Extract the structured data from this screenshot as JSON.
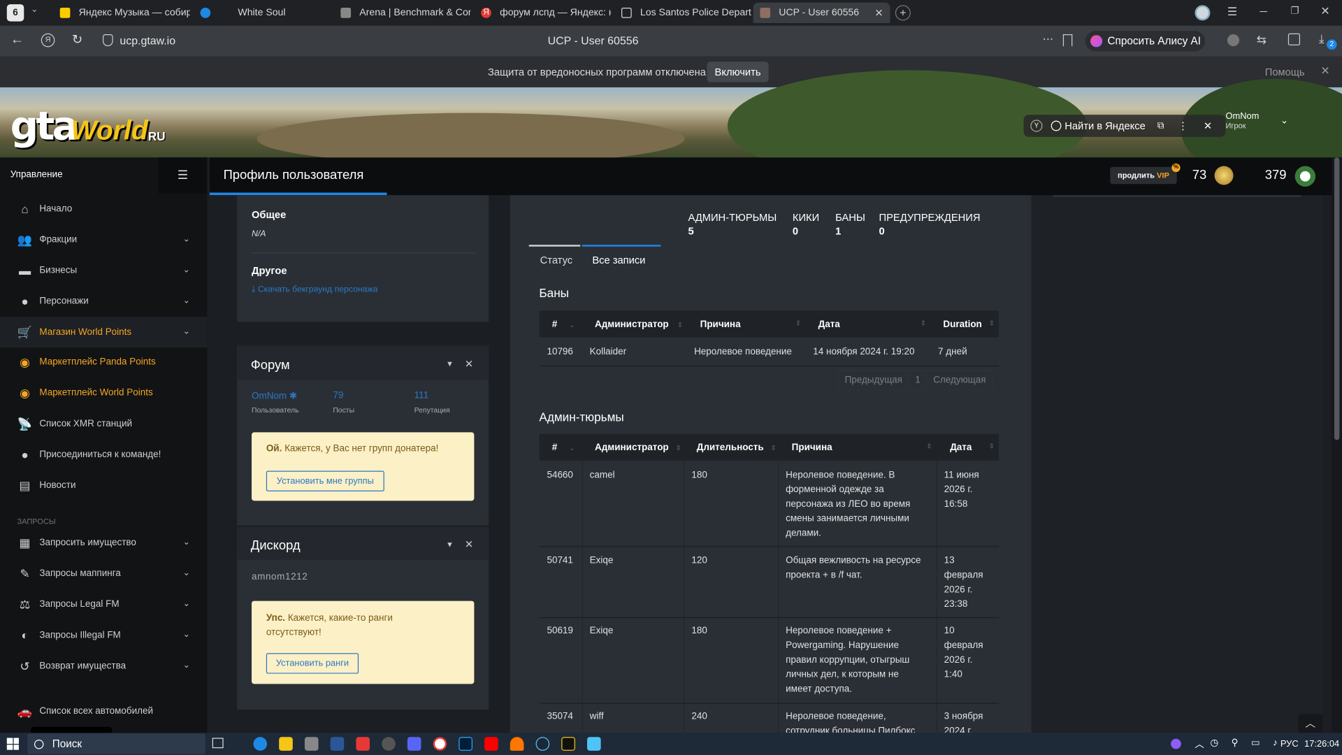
{
  "browser": {
    "tab_counter": "6",
    "tabs": [
      {
        "label": "Яндекс Музыка — собирае",
        "color": "#ffcc00"
      },
      {
        "label": "White Soul",
        "color": "#1e88e5"
      },
      {
        "label": "Arena | Benchmark & Com",
        "color": "#888888"
      },
      {
        "label": "форум лспд — Яндекс: на",
        "color": "#e53935"
      },
      {
        "label": "Los Santos Police Departm",
        "color": "#cfd8dc"
      },
      {
        "label": "UCP - User 60556",
        "color": "#8d6e63"
      }
    ],
    "url": "ucp.gtaw.io",
    "page_title": "UCP - User 60556",
    "alice_button": "Спросить Алису AI",
    "download_badge": "2"
  },
  "notice": {
    "text": "Защита от вредоносных программ отключена",
    "enable_button": "Включить",
    "help": "Помощь"
  },
  "banner": {
    "logo_gta": "gta",
    "logo_world": "World",
    "logo_ru": "RU",
    "yandex_search": "Найти в Яндексе",
    "user_name": "OmNom",
    "user_role": "Игрок"
  },
  "sidebar": {
    "title": "Управление",
    "items": [
      {
        "label": "Начало",
        "icon": "home-icon"
      },
      {
        "label": "Фракции",
        "icon": "users-icon"
      },
      {
        "label": "Бизнесы",
        "icon": "briefcase-icon"
      },
      {
        "label": "Персонажи",
        "icon": "person-icon"
      },
      {
        "label": "Магазин World Points",
        "icon": "cart-icon"
      },
      {
        "label": "Маркетплейс Panda Points",
        "icon": "coins-icon"
      },
      {
        "label": "Маркетплейс World Points",
        "icon": "coins-icon"
      },
      {
        "label": "Список XMR станций",
        "icon": "radio-icon"
      },
      {
        "label": "Присоединиться к команде!",
        "icon": "person-plus-icon"
      },
      {
        "label": "Новости",
        "icon": "news-icon"
      }
    ],
    "section_requests": "ЗАПРОСЫ",
    "requests": [
      {
        "label": "Запросить имущество",
        "icon": "building-icon"
      },
      {
        "label": "Запросы маппинга",
        "icon": "brush-icon"
      },
      {
        "label": "Запросы Legal FM",
        "icon": "scale-icon"
      },
      {
        "label": "Запросы Illegal FM",
        "icon": "mask-icon"
      },
      {
        "label": "Возврат имущества",
        "icon": "undo-icon"
      }
    ],
    "all_vehicles": "Список всех автомобилей"
  },
  "header": {
    "title": "Профиль пользователя",
    "vip_button": "продлить",
    "vip_label": "VIP",
    "points_world": "73",
    "points_panda": "379"
  },
  "profile": {
    "general_label": "Общее",
    "general_value": "N/A",
    "other_label": "Другое",
    "download_link": "Скачать бекграунд персонажа"
  },
  "forum": {
    "title": "Форум",
    "user": "OmNom",
    "user_caption": "Пользователь",
    "posts": "79",
    "posts_caption": "Посты",
    "rep": "111",
    "rep_caption": "Репутация",
    "warn_bold": "Ой.",
    "warn_text": "Кажется, у Вас нет групп донатера!",
    "warn_button": "Установить мне группы"
  },
  "discord": {
    "title": "Дискорд",
    "username": "amnom1212",
    "warn_bold": "Упс.",
    "warn_text_1": "Кажется, какие-то ранги",
    "warn_text_2": "отсутствуют!",
    "warn_button": "Установить ранги"
  },
  "stats": [
    {
      "label": "АДМИН-ТЮРЬМЫ",
      "value": "5"
    },
    {
      "label": "КИКИ",
      "value": "0"
    },
    {
      "label": "БАНЫ",
      "value": "1"
    },
    {
      "label": "ПРЕДУПРЕЖДЕНИЯ",
      "value": "0"
    }
  ],
  "tabs": {
    "status": "Статус",
    "all": "Все записи"
  },
  "bans": {
    "title": "Баны",
    "headers": [
      "#",
      "Администратор",
      "Причина",
      "Дата",
      "Duration"
    ],
    "rows": [
      [
        "10796",
        "Kollaider",
        "Неролевое поведение",
        "14 ноября 2024 г. 19:20",
        "7 дней"
      ]
    ],
    "prev": "Предыдущая",
    "page": "1",
    "next": "Следующая"
  },
  "jails": {
    "title": "Админ-тюрьмы",
    "headers": [
      "#",
      "Администратор",
      "Длительность",
      "Причина",
      "Дата"
    ],
    "rows": [
      {
        "id": "54660",
        "admin": "camel",
        "dur": "180",
        "reason": [
          "Неролевое поведение. В",
          "форменной одежде за",
          "персонажа из ЛЕО во время",
          "смены занимается личными",
          "делами."
        ],
        "date": [
          "11 июня",
          "2026 г.",
          "16:58"
        ]
      },
      {
        "id": "50741",
        "admin": "Exiqe",
        "dur": "120",
        "reason": [
          "Общая вежливость на ресурсе",
          "проекта + в /f чат."
        ],
        "date": [
          "13",
          "февраля",
          "2026 г.",
          "23:38"
        ]
      },
      {
        "id": "50619",
        "admin": "Exiqe",
        "dur": "180",
        "reason": [
          "Неролевое поведение +",
          "Powergaming. Нарушение",
          "правил коррупции, отыгрыш",
          "личных дел, к которым не",
          "имеет доступа."
        ],
        "date": [
          "10",
          "февраля",
          "2026 г.",
          "1:40"
        ]
      },
      {
        "id": "35074",
        "admin": "wiff",
        "dur": "240",
        "reason": [
          "Неролевое поведение,",
          "сотрудник больницы Пилбокс"
        ],
        "date": [
          "3 ноября",
          "2024 г."
        ]
      }
    ]
  },
  "taskbar": {
    "search": "Поиск",
    "lang": "РУС",
    "time": "17:26:04"
  }
}
